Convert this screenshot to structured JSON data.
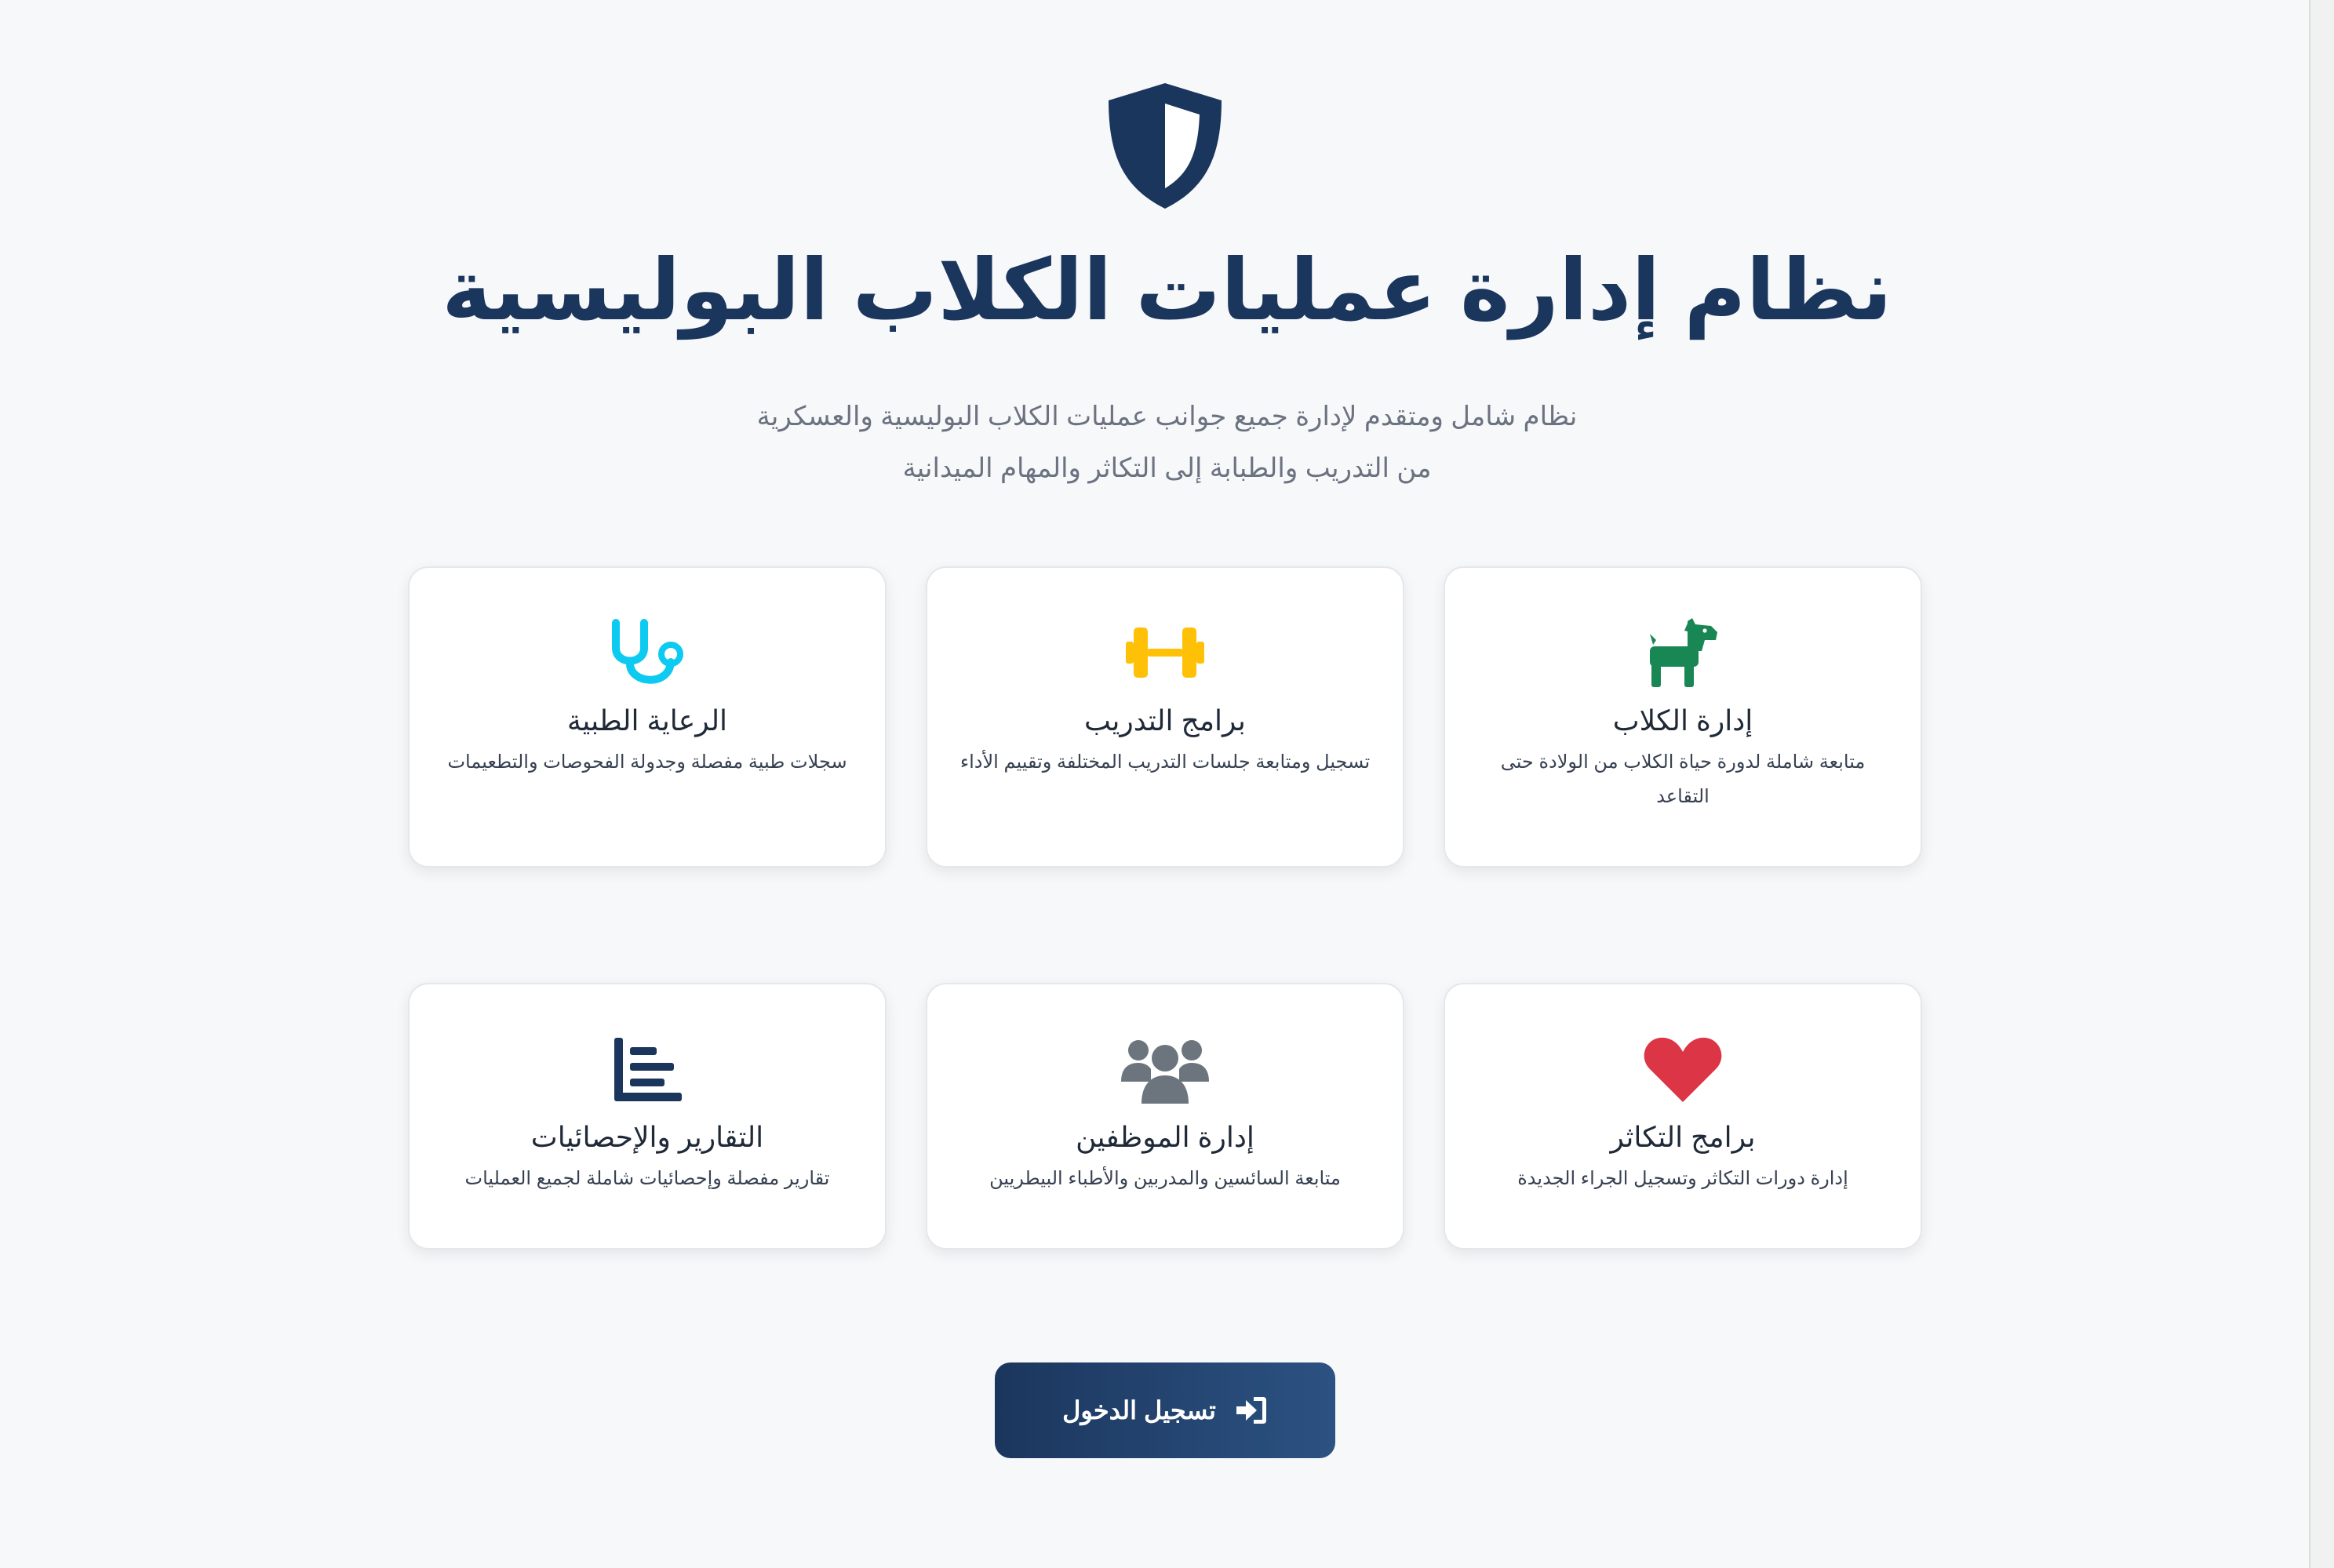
{
  "header": {
    "icon": "shield-icon",
    "title": "نظام إدارة عمليات الكلاب البوليسية",
    "subtitle_line1": "نظام شامل ومتقدم لإدارة جميع جوانب عمليات الكلاب البوليسية والعسكرية",
    "subtitle_line2": "من التدريب والطبابة إلى التكاثر والمهام الميدانية"
  },
  "features": [
    {
      "icon": "dog-icon",
      "color": "#198754",
      "title": "إدارة الكلاب",
      "description": "متابعة شاملة لدورة حياة الكلاب من الولادة حتى التقاعد"
    },
    {
      "icon": "dumbbell-icon",
      "color": "#ffc107",
      "title": "برامج التدريب",
      "description": "تسجيل ومتابعة جلسات التدريب المختلفة وتقييم الأداء"
    },
    {
      "icon": "stethoscope-icon",
      "color": "#0dcaf0",
      "title": "الرعاية الطبية",
      "description": "سجلات طبية مفصلة وجدولة الفحوصات والتطعيمات"
    },
    {
      "icon": "heart-icon",
      "color": "#dc3545",
      "title": "برامج التكاثر",
      "description": "إدارة دورات التكاثر وتسجيل الجراء الجديدة"
    },
    {
      "icon": "users-icon",
      "color": "#6c757d",
      "title": "إدارة الموظفين",
      "description": "متابعة السائسين والمدربين والأطباء البيطريين"
    },
    {
      "icon": "chart-icon",
      "color": "#1b365d",
      "title": "التقارير والإحصائيات",
      "description": "تقارير مفصلة وإحصائيات شاملة لجميع العمليات"
    }
  ],
  "login": {
    "label": "تسجيل الدخول",
    "icon": "sign-in-icon"
  },
  "colors": {
    "primary": "#1b365d",
    "background": "#f7f8fa"
  }
}
